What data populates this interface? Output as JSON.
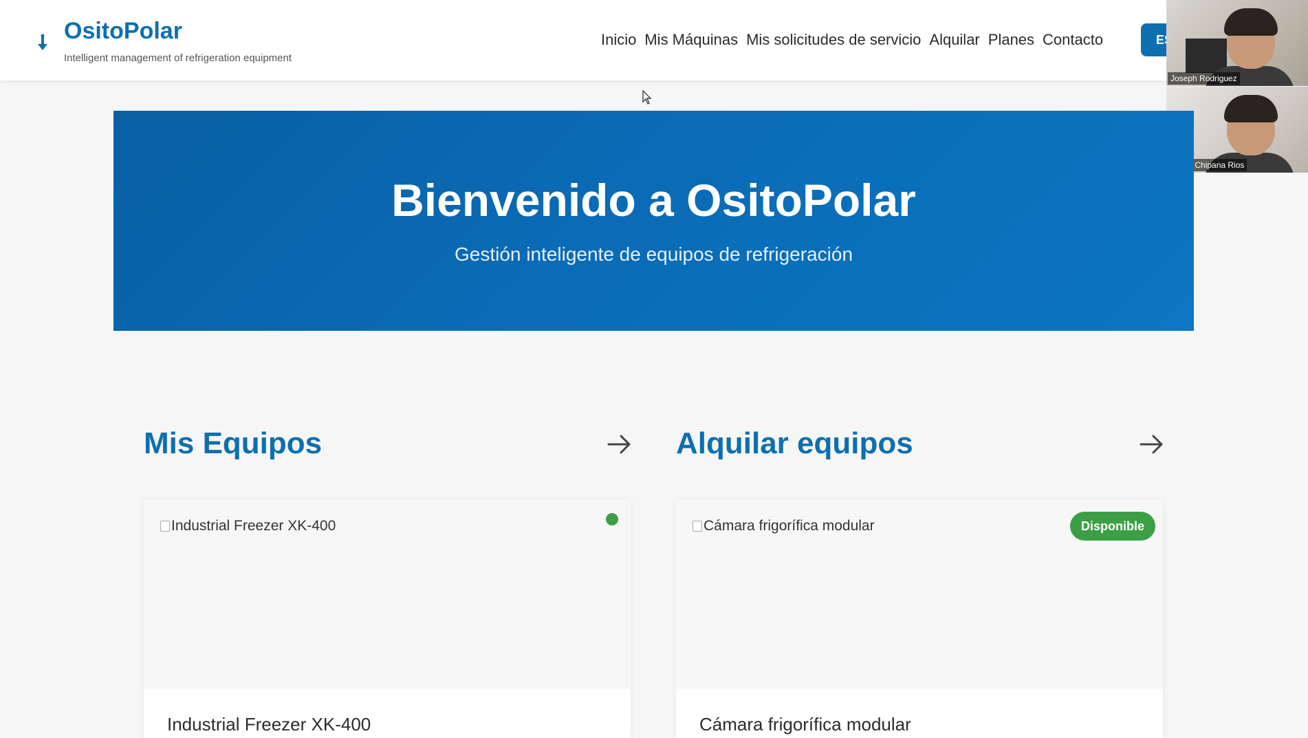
{
  "header": {
    "brand": "OsitoPolar",
    "tagline": "Intelligent management of refrigeration equipment",
    "nav": [
      "Inicio",
      "Mis Máquinas",
      "Mis solicitudes de servicio",
      "Alquilar",
      "Planes",
      "Contacto"
    ],
    "lang_button": "ES",
    "logo_icon": "thermometer-arrow-icon"
  },
  "video_call": {
    "participants": [
      "Joseph Rodriguez",
      "Andre Chipana Rios"
    ]
  },
  "hero": {
    "title": "Bienvenido a OsitoPolar",
    "subtitle": "Gestión inteligente de equipos de refrigeración"
  },
  "sections": {
    "my_equipment": {
      "title": "Mis Equipos",
      "card": {
        "image_alt": "Industrial Freezer XK-400",
        "title": "Industrial Freezer XK-400",
        "status_color": "#3f9f46"
      }
    },
    "rent_equipment": {
      "title": "Alquilar equipos",
      "card": {
        "image_alt": "Cámara frigorífica modular",
        "title": "Cámara frigorífica modular",
        "badge": "Disponible",
        "badge_color": "#3d9f45"
      }
    }
  },
  "colors": {
    "brand": "#0d6fb0",
    "hero_bg": "#0a6bb6"
  }
}
